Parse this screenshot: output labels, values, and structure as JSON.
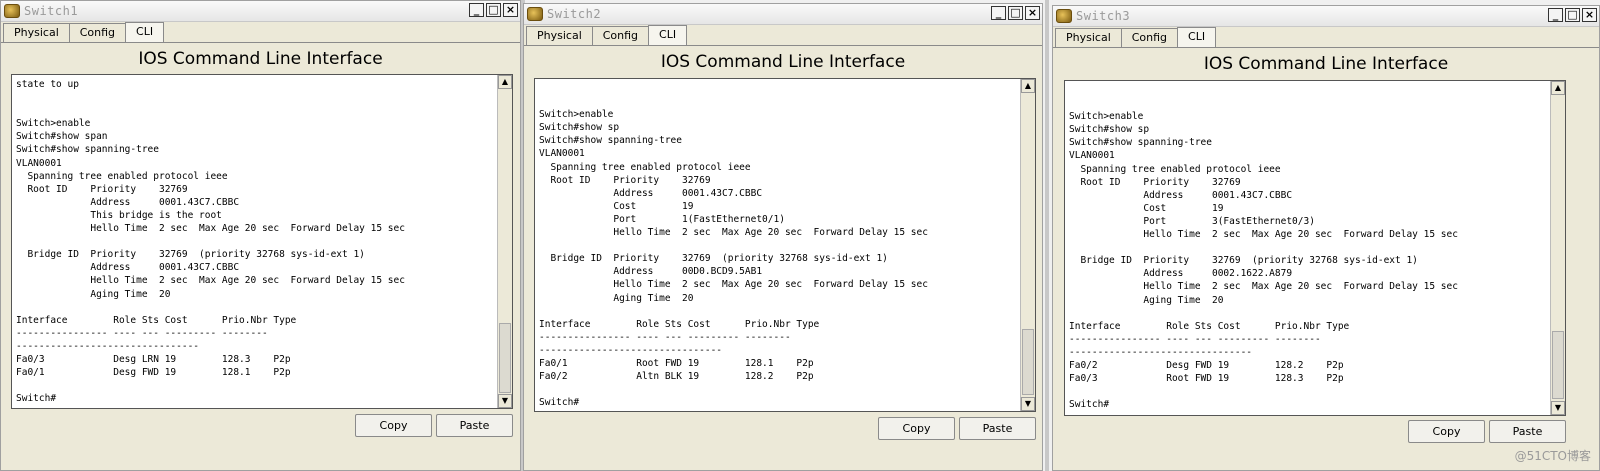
{
  "tabs": [
    "Physical",
    "Config",
    "CLI"
  ],
  "header": "IOS Command Line Interface",
  "buttons": {
    "copy": "Copy",
    "paste": "Paste"
  },
  "watermark": "@51CTO博客",
  "windows": [
    {
      "title": "Switch1",
      "terminal": "state to up\n\n\nSwitch>enable\nSwitch#show span\nSwitch#show spanning-tree\nVLAN0001\n  Spanning tree enabled protocol ieee\n  Root ID    Priority    32769\n             Address     0001.43C7.CBBC\n             This bridge is the root\n             Hello Time  2 sec  Max Age 20 sec  Forward Delay 15 sec\n\n  Bridge ID  Priority    32769  (priority 32768 sys-id-ext 1)\n             Address     0001.43C7.CBBC\n             Hello Time  2 sec  Max Age 20 sec  Forward Delay 15 sec\n             Aging Time  20\n\nInterface        Role Sts Cost      Prio.Nbr Type\n---------------- ---- --- --------- --------\n--------------------------------\nFa0/3            Desg LRN 19        128.3    P2p\nFa0/1            Desg FWD 19        128.1    P2p\n\nSwitch#"
    },
    {
      "title": "Switch2",
      "terminal": "\n\nSwitch>enable\nSwitch#show sp\nSwitch#show spanning-tree\nVLAN0001\n  Spanning tree enabled protocol ieee\n  Root ID    Priority    32769\n             Address     0001.43C7.CBBC\n             Cost        19\n             Port        1(FastEthernet0/1)\n             Hello Time  2 sec  Max Age 20 sec  Forward Delay 15 sec\n\n  Bridge ID  Priority    32769  (priority 32768 sys-id-ext 1)\n             Address     00D0.BCD9.5AB1\n             Hello Time  2 sec  Max Age 20 sec  Forward Delay 15 sec\n             Aging Time  20\n\nInterface        Role Sts Cost      Prio.Nbr Type\n---------------- ---- --- --------- --------\n--------------------------------\nFa0/1            Root FWD 19        128.1    P2p\nFa0/2            Altn BLK 19        128.2    P2p\n\nSwitch#"
    },
    {
      "title": "Switch3",
      "terminal": "\n\nSwitch>enable\nSwitch#show sp\nSwitch#show spanning-tree\nVLAN0001\n  Spanning tree enabled protocol ieee\n  Root ID    Priority    32769\n             Address     0001.43C7.CBBC\n             Cost        19\n             Port        3(FastEthernet0/3)\n             Hello Time  2 sec  Max Age 20 sec  Forward Delay 15 sec\n\n  Bridge ID  Priority    32769  (priority 32768 sys-id-ext 1)\n             Address     0002.1622.A879\n             Hello Time  2 sec  Max Age 20 sec  Forward Delay 15 sec\n             Aging Time  20\n\nInterface        Role Sts Cost      Prio.Nbr Type\n---------------- ---- --- --------- --------\n--------------------------------\nFa0/2            Desg FWD 19        128.2    P2p\nFa0/3            Root FWD 19        128.3    P2p\n\nSwitch#"
    }
  ]
}
